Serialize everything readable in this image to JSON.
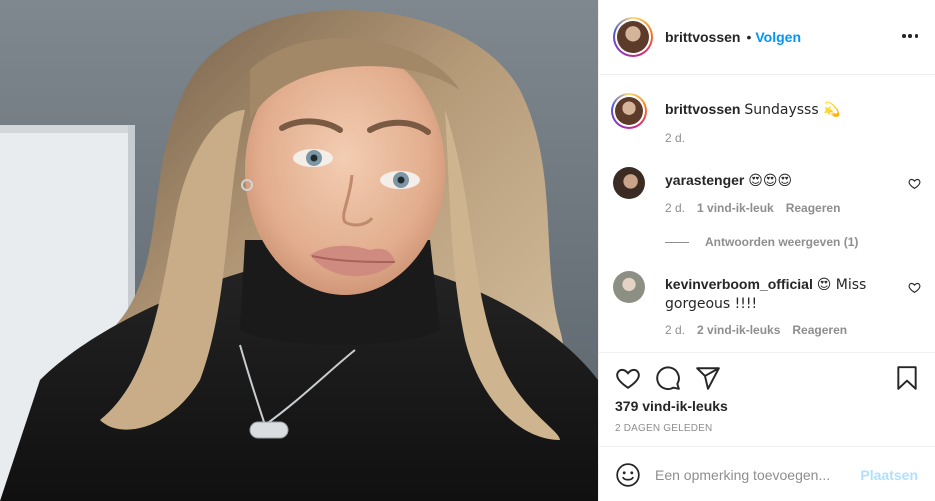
{
  "post": {
    "author": "brittvossen",
    "separator": "•",
    "follow_label": "Volgen",
    "more_icon": "more-horizontal-icon"
  },
  "caption": {
    "username": "brittvossen",
    "text": "Sundaysss 💫",
    "age": "2 d."
  },
  "comments": [
    {
      "username": "yarastenger",
      "text": "😍😍😍",
      "age": "2 d.",
      "likes": "1 vind-ik-leuk",
      "reply_label": "Reageren"
    },
    {
      "username": "kevinverboom_official",
      "text": "😍 Miss gorgeous !!!!",
      "age": "2 d.",
      "likes": "2 vind-ik-leuks",
      "reply_label": "Reageren"
    }
  ],
  "view_replies": "Antwoorden weergeven (1)",
  "actions": {
    "icons": [
      "heart-icon",
      "comment-icon",
      "share-icon",
      "bookmark-icon"
    ],
    "likes_count": "379 vind-ik-leuks",
    "posted_ago": "2 DAGEN GELEDEN"
  },
  "add_comment": {
    "placeholder": "Een opmerking toevoegen...",
    "post_label": "Plaatsen"
  },
  "colors": {
    "follow_blue": "#0095f6",
    "post_disabled": "#b2dffc",
    "muted": "#8e8e8e",
    "text": "#262626"
  }
}
